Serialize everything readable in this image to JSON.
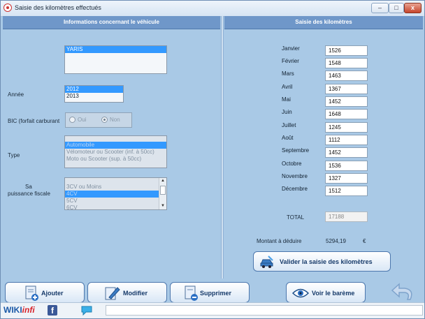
{
  "window": {
    "title": "Saisie des kilomètres effectués",
    "controls": {
      "minimize": "–",
      "maximize": "□",
      "close": "x"
    }
  },
  "left_panel": {
    "header": "Informations concernant le véhicule",
    "vehicle_list": [
      "YARIS"
    ],
    "vehicle_selected": "YARIS",
    "annee_label": "Année",
    "annee_options": [
      "2012",
      "2013"
    ],
    "annee_selected": "2012",
    "bic_label": "BIC (forfait carburant",
    "bic_oui": "Oui",
    "bic_non": "Non",
    "type_label": "Type",
    "type_options": [
      "Automobile",
      "Vélomoteur ou Scooter (inf. à 50cc)",
      "Moto ou Scooter  (sup. à 50cc)"
    ],
    "type_selected": "Automobile",
    "puissance_label_1": "Sa",
    "puissance_label_2": "puissance fiscale",
    "puissance_options": [
      "3CV ou Moins",
      "4CV",
      "5CV",
      "6CV"
    ],
    "puissance_selected": "4CV"
  },
  "right_panel": {
    "header": "Saisie des kilomètres",
    "months": [
      {
        "label": "Janvier",
        "value": "1526"
      },
      {
        "label": "Février",
        "value": "1548"
      },
      {
        "label": "Mars",
        "value": "1463"
      },
      {
        "label": "Avril",
        "value": "1367"
      },
      {
        "label": "Mai",
        "value": "1452"
      },
      {
        "label": "Juin",
        "value": "1648"
      },
      {
        "label": "Juillet",
        "value": "1245"
      },
      {
        "label": "Août",
        "value": "1112"
      },
      {
        "label": "Septembre",
        "value": "1452"
      },
      {
        "label": "Octobre",
        "value": "1536"
      },
      {
        "label": "Novembre",
        "value": "1327"
      },
      {
        "label": "Décembre",
        "value": "1512"
      }
    ],
    "total_label": "TOTAL",
    "total_value": "17188",
    "montant_label": "Montant à déduire",
    "montant_value": "5294,19",
    "currency": "€",
    "validate_button": "Valider la saisie des kilomètres"
  },
  "toolbar": {
    "add_label": "Ajouter",
    "edit_label": "Modifier",
    "delete_label": "Supprimer",
    "bareme_label": "Voir le barème"
  },
  "footer": {
    "logo_wiki": "WIKI",
    "logo_infi": "infi",
    "facebook": "f"
  },
  "colors": {
    "panel_bg": "#a9c9e6",
    "header_bg": "#6f97c9",
    "selection": "#3399ff",
    "button_text": "#163a6a"
  }
}
